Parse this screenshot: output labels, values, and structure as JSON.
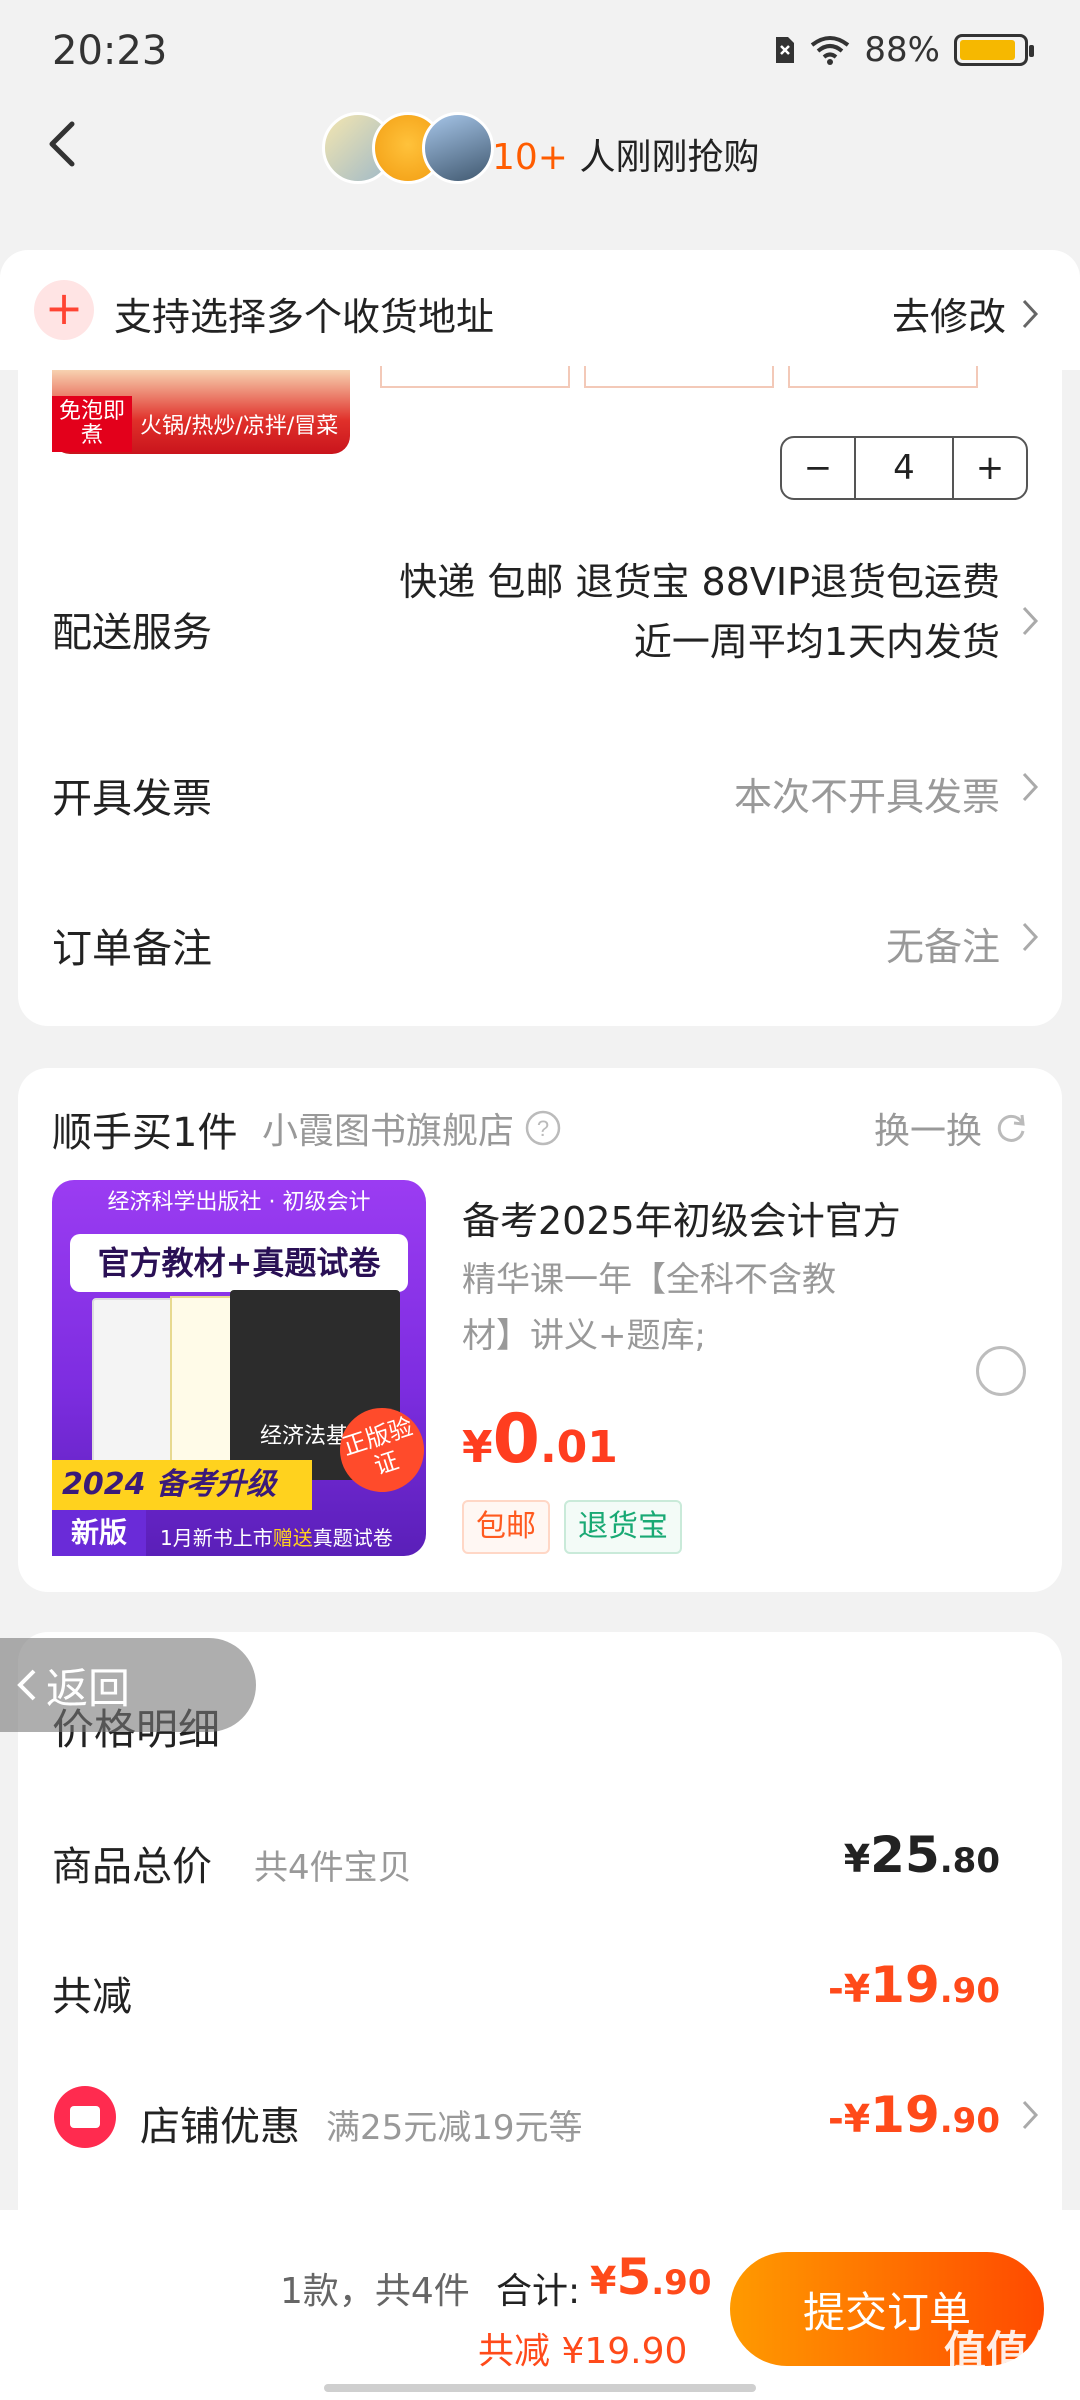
{
  "status": {
    "time": "20:23",
    "battery": "88%",
    "battery_level": 0.88
  },
  "header": {
    "buyers_count": "10+",
    "buyers_text": "人刚刚抢购"
  },
  "address_bar": {
    "text": "支持选择多个收货地址",
    "action": "去修改"
  },
  "product": {
    "badge_left": "免泡即煮",
    "badge_right": "火锅/热炒/凉拌/冒菜",
    "quantity": "4",
    "minus": "−",
    "plus": "+"
  },
  "delivery": {
    "label": "配送服务",
    "line1": "快递 包邮 退货宝 88VIP退货包运费",
    "line2": "近一周平均1天内发货"
  },
  "invoice": {
    "label": "开具发票",
    "value": "本次不开具发票"
  },
  "remark": {
    "label": "订单备注",
    "value": "无备注"
  },
  "addon": {
    "title": "顺手买1件",
    "store": "小霞图书旗舰店",
    "switch_label": "换一换",
    "product_title": "备考2025年初级会计官方",
    "product_desc": "精华课一年【全科不含教材】讲义+题库;",
    "price_symbol": "¥",
    "price_int": "0",
    "price_dec": ".01",
    "badge1": "包邮",
    "badge2": "退货宝",
    "image": {
      "top_text": "经济科学出版社 · 初级会计",
      "banner": "官方教材+真题试卷",
      "cover3": "经济法基础",
      "stamp": "正版验证",
      "upgrade": "2024 备考升级",
      "new": "新版",
      "footer_a": "1月新书上市",
      "footer_b": "赠送",
      "footer_c": "真题试卷"
    }
  },
  "price_detail": {
    "return_label": "返回",
    "title": "价格明细",
    "total_label": "商品总价",
    "total_note": "共4件宝贝",
    "total_symbol": "¥",
    "total_int": "25",
    "total_dec": ".80",
    "reduce_label": "共减",
    "reduce_symbol": "-¥",
    "reduce_int": "19",
    "reduce_dec": ".90",
    "shop_label": "店铺优惠",
    "shop_note": "满25元减19元等",
    "shop_symbol": "-¥",
    "shop_int": "19",
    "shop_dec": ".90"
  },
  "bottom": {
    "summary": "1款，共4件",
    "total_label": "合计:",
    "total_symbol": "¥",
    "total_int": "5",
    "total_dec": ".90",
    "reduce_text": "共减 ¥19.90",
    "submit": "提交订单",
    "watermark": "值值值",
    "watermark_url": "zhizhizhi.com"
  },
  "colors": {
    "accent": "#ff5c00",
    "price": "#ff4a1a",
    "green": "#19a974"
  }
}
